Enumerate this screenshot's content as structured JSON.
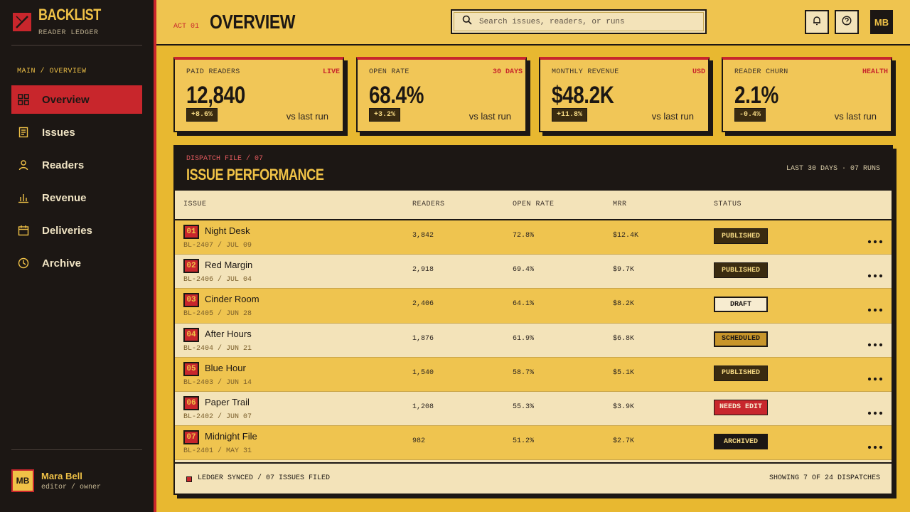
{
  "brand": {
    "name": "BACKLIST",
    "sub": "READER LEDGER"
  },
  "sidebar": {
    "crumb": "MAIN / OVERVIEW",
    "items": [
      {
        "label": "Overview",
        "icon": "grid-icon",
        "active": true
      },
      {
        "label": "Issues",
        "icon": "document-icon"
      },
      {
        "label": "Readers",
        "icon": "user-icon"
      },
      {
        "label": "Revenue",
        "icon": "bar-chart-icon"
      },
      {
        "label": "Deliveries",
        "icon": "calendar-icon"
      },
      {
        "label": "Archive",
        "icon": "clock-icon"
      }
    ],
    "user": {
      "initials": "MB",
      "name": "Mara Bell",
      "role": "editor / owner"
    }
  },
  "header": {
    "act": "ACT 01",
    "title": "OVERVIEW",
    "search_placeholder": "Search issues, readers, or runs",
    "avatar": "MB"
  },
  "stats": [
    {
      "label": "PAID READERS",
      "tag": "LIVE",
      "value": "12,840",
      "delta": "+8.6%",
      "vs": "vs last run"
    },
    {
      "label": "OPEN RATE",
      "tag": "30 DAYS",
      "value": "68.4%",
      "delta": "+3.2%",
      "vs": "vs last run"
    },
    {
      "label": "MONTHLY REVENUE",
      "tag": "USD",
      "value": "$48.2K",
      "delta": "+11.8%",
      "vs": "vs last run"
    },
    {
      "label": "READER CHURN",
      "tag": "HEALTH",
      "value": "2.1%",
      "delta": "-0.4%",
      "vs": "vs last run"
    }
  ],
  "panel": {
    "dispatch": "DISPATCH FILE / 07",
    "title": "ISSUE PERFORMANCE",
    "meta": "LAST 30 DAYS · 07 RUNS",
    "columns": {
      "issue": "ISSUE",
      "readers": "READERS",
      "open_rate": "OPEN RATE",
      "mrr": "MRR",
      "status": "STATUS"
    },
    "rows": [
      {
        "num": "01",
        "name": "Night Desk",
        "code": "BL-2407 / JUL 09",
        "readers": "3,842",
        "open_rate": "72.8%",
        "mrr": "$12.4K",
        "status": "PUBLISHED",
        "kind": "published"
      },
      {
        "num": "02",
        "name": "Red Margin",
        "code": "BL-2406 / JUL 04",
        "readers": "2,918",
        "open_rate": "69.4%",
        "mrr": "$9.7K",
        "status": "PUBLISHED",
        "kind": "published"
      },
      {
        "num": "03",
        "name": "Cinder Room",
        "code": "BL-2405 / JUN 28",
        "readers": "2,406",
        "open_rate": "64.1%",
        "mrr": "$8.2K",
        "status": "DRAFT",
        "kind": "draft"
      },
      {
        "num": "04",
        "name": "After Hours",
        "code": "BL-2404 / JUN 21",
        "readers": "1,876",
        "open_rate": "61.9%",
        "mrr": "$6.8K",
        "status": "SCHEDULED",
        "kind": "scheduled"
      },
      {
        "num": "05",
        "name": "Blue Hour",
        "code": "BL-2403 / JUN 14",
        "readers": "1,540",
        "open_rate": "58.7%",
        "mrr": "$5.1K",
        "status": "PUBLISHED",
        "kind": "published"
      },
      {
        "num": "06",
        "name": "Paper Trail",
        "code": "BL-2402 / JUN 07",
        "readers": "1,208",
        "open_rate": "55.3%",
        "mrr": "$3.9K",
        "status": "NEEDS EDIT",
        "kind": "needs"
      },
      {
        "num": "07",
        "name": "Midnight File",
        "code": "BL-2401 / MAY 31",
        "readers": "982",
        "open_rate": "51.2%",
        "mrr": "$2.7K",
        "status": "ARCHIVED",
        "kind": "archived"
      }
    ],
    "footer_left": "LEDGER SYNCED / 07 ISSUES FILED",
    "footer_right": "SHOWING 7 OF 24 DISPATCHES"
  },
  "colors": {
    "accent": "#c8262c",
    "mustard": "#efc44f",
    "ink": "#1c1714",
    "cream": "#f3e3b9"
  }
}
